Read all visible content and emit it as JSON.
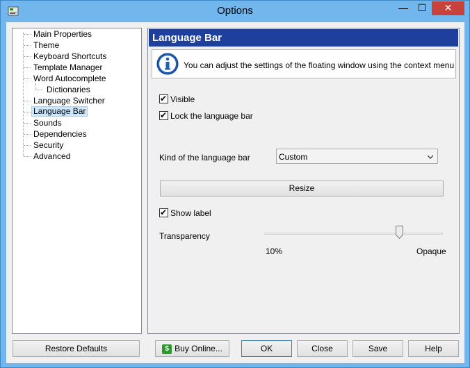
{
  "window": {
    "title": "Options",
    "min_glyph": "—",
    "max_glyph": "☐",
    "close_glyph": "✕"
  },
  "tree": {
    "items": [
      {
        "label": "Main Properties"
      },
      {
        "label": "Theme"
      },
      {
        "label": "Keyboard Shortcuts"
      },
      {
        "label": "Template Manager"
      },
      {
        "label": "Word Autocomplete"
      },
      {
        "label": "Dictionaries"
      },
      {
        "label": "Language Switcher"
      },
      {
        "label": "Language Bar",
        "selected": true
      },
      {
        "label": "Sounds"
      },
      {
        "label": "Dependencies"
      },
      {
        "label": "Security"
      },
      {
        "label": "Advanced"
      }
    ]
  },
  "panel": {
    "header": "Language Bar",
    "info_text": "You can adjust the settings of the floating window using the context menu",
    "visible_label": "Visible",
    "visible_checked": true,
    "lock_label": "Lock the language bar",
    "lock_checked": true,
    "kind_label": "Kind of the language bar",
    "kind_value": "Custom",
    "resize_label": "Resize",
    "show_label_label": "Show label",
    "show_label_checked": true,
    "transparency_label": "Transparency",
    "slider_min_label": "10%",
    "slider_max_label": "Opaque",
    "slider_value_fraction": 0.76
  },
  "buttons": {
    "restore": "Restore Defaults",
    "buy": "Buy Online...",
    "ok": "OK",
    "close": "Close",
    "save": "Save",
    "help": "Help"
  },
  "colors": {
    "header_bg": "#1f3f9d",
    "title_bg": "#71b7ee",
    "close_btn": "#c7423a",
    "selection": "#cce8ff"
  }
}
